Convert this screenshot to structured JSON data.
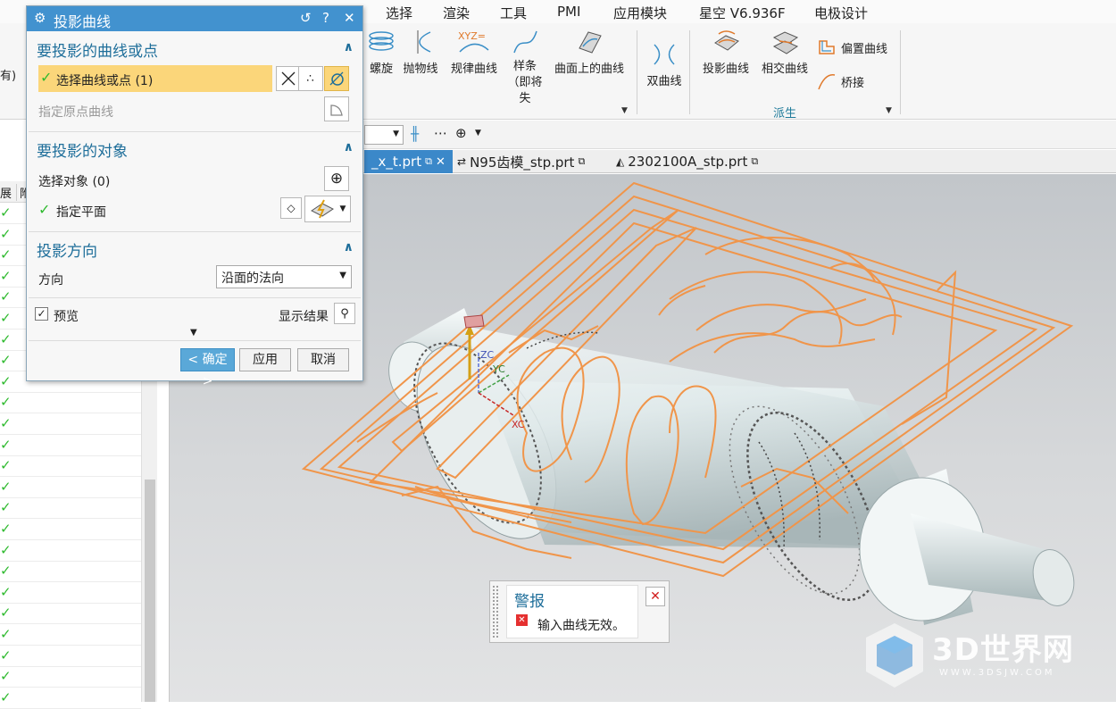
{
  "menubar": {
    "items": [
      "选择",
      "渲染",
      "工具",
      "PMI",
      "应用模块",
      "星空 V6.936F",
      "电极设计"
    ]
  },
  "ribbon": {
    "curve_buttons": [
      "螺旋",
      "抛物线",
      "规律曲线",
      "样条（即将失",
      "曲面上的曲线"
    ],
    "double_curve": "双曲线",
    "derived_buttons": [
      "投影曲线",
      "相交曲线"
    ],
    "small_buttons": [
      "偏置曲线",
      "桥接"
    ],
    "group_label": "派生",
    "left_text": "有)"
  },
  "tabs": [
    {
      "label": "_x_t.prt",
      "active": true
    },
    {
      "label": "N95齿模_stp.prt",
      "active": false
    },
    {
      "label": "2302100A_stp.prt",
      "active": false
    }
  ],
  "navigator": {
    "headers": [
      "展",
      "附"
    ],
    "check_symbol": "✓",
    "rows": 24
  },
  "dialog": {
    "title": "投影曲线",
    "sections": {
      "curves": {
        "title": "要投影的曲线或点",
        "select_label": "选择曲线或点 (1)",
        "origin_label": "指定原点曲线"
      },
      "objects": {
        "title": "要投影的对象",
        "select_label": "选择对象 (0)",
        "plane_label": "指定平面"
      },
      "direction": {
        "title": "投影方向",
        "label": "方向",
        "value": "沿面的法向"
      }
    },
    "preview_label": "预览",
    "show_result_label": "显示结果",
    "ok_label": "< 确定 >",
    "apply_label": "应用",
    "cancel_label": "取消"
  },
  "alert": {
    "title": "警报",
    "message": "输入曲线无效。"
  },
  "watermark": {
    "brand": "3D世界网",
    "url": "WWW.3DSJW.COM"
  },
  "triad": {
    "zc": "ZC",
    "yc": "YC",
    "xc": "XC"
  },
  "colors": {
    "accent_blue": "#4292cf",
    "curve_orange": "#f0954a",
    "select_yellow": "#fbd67a",
    "check_green": "#2fba2f",
    "alert_red": "#e53030"
  }
}
